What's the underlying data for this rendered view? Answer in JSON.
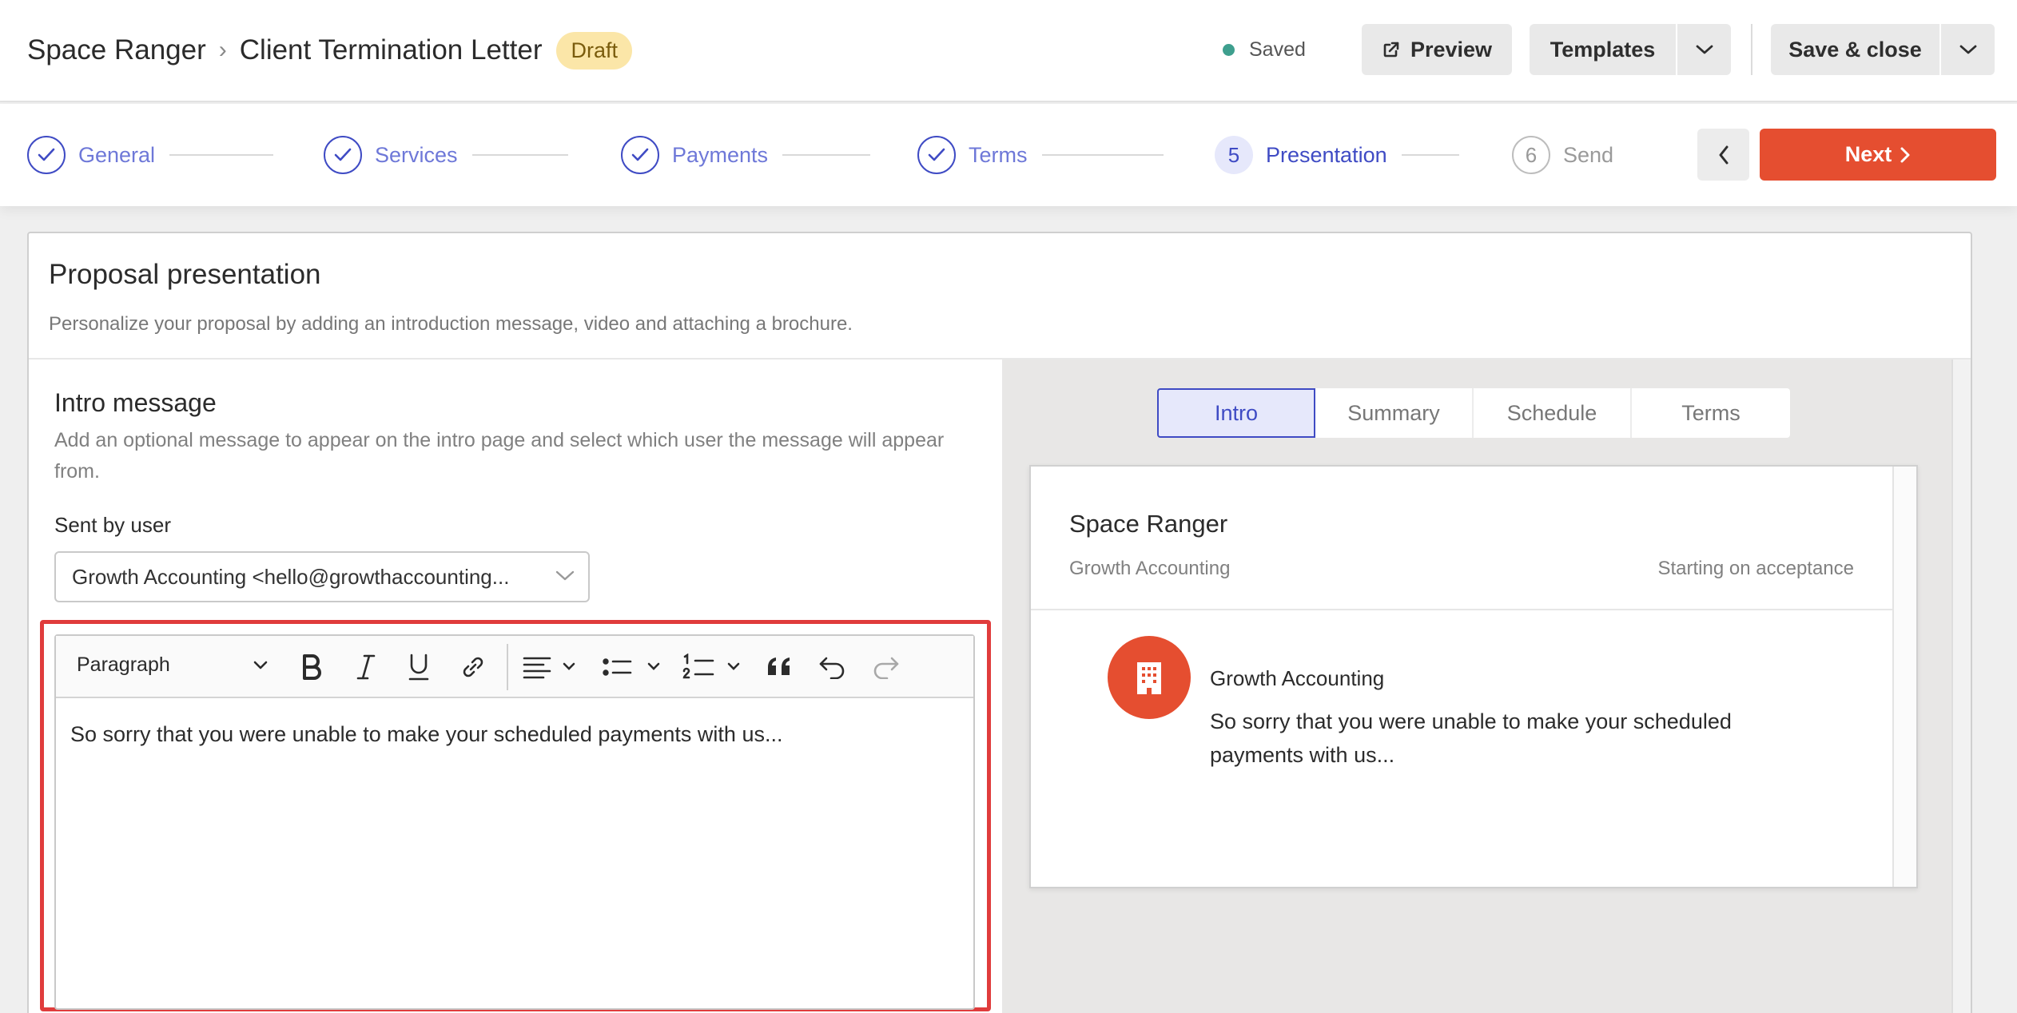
{
  "header": {
    "org_name": "Space Ranger",
    "doc_title": "Client Termination Letter",
    "status_badge": "Draft",
    "save_status": "Saved",
    "preview_label": "Preview",
    "templates_label": "Templates",
    "save_close_label": "Save & close",
    "colors": {
      "saved_dot": "#3e9f8e",
      "badge_bg": "#fbe6a8"
    }
  },
  "steps": {
    "items": [
      {
        "label": "General",
        "state": "done"
      },
      {
        "label": "Services",
        "state": "done"
      },
      {
        "label": "Payments",
        "state": "done"
      },
      {
        "label": "Terms",
        "state": "done"
      },
      {
        "label": "Presentation",
        "state": "current",
        "number": "5"
      },
      {
        "label": "Send",
        "state": "pending",
        "number": "6"
      }
    ],
    "next_label": "Next",
    "colors": {
      "accent": "#3f4bc4",
      "next_bg": "#e54e30"
    }
  },
  "card": {
    "title": "Proposal presentation",
    "subtitle": "Personalize your proposal by adding an introduction message, video and attaching a brochure."
  },
  "intro": {
    "heading": "Intro message",
    "description": "Add an optional message to appear on the intro page and select which user the message will appear from.",
    "sent_by_label": "Sent by user",
    "sent_by_value": "Growth Accounting <hello@growthaccounting...",
    "editor": {
      "block_format": "Paragraph",
      "content": "So sorry that you were unable to make your scheduled payments with us..."
    }
  },
  "preview": {
    "tabs": [
      "Intro",
      "Summary",
      "Schedule",
      "Terms"
    ],
    "active_tab": "Intro",
    "title": "Space Ranger",
    "org": "Growth Accounting",
    "start": "Starting on acceptance",
    "from_name": "Growth Accounting",
    "message": "So sorry that you were unable to make your scheduled payments with us..."
  }
}
